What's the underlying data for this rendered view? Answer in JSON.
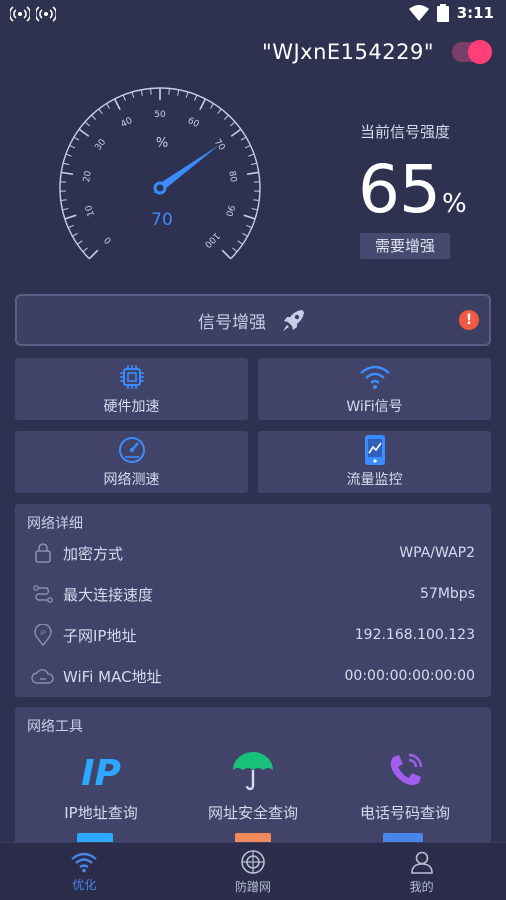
{
  "statusbar": {
    "time": "3:11",
    "icons": [
      "hotspot-icon",
      "hotspot-icon",
      "wifi-icon",
      "battery-icon"
    ]
  },
  "network": {
    "ssid": "\"WJxnE154229\"",
    "toggle_on": true
  },
  "gauge": {
    "value": 70,
    "unit": "%",
    "ticks": [
      "0",
      "10",
      "20",
      "30",
      "40",
      "50",
      "60",
      "70",
      "80",
      "90",
      "100"
    ],
    "accent": "#3a8cff"
  },
  "signal": {
    "label": "当前信号强度",
    "value": "65",
    "unit": "%",
    "badge": "需要增强"
  },
  "boost": {
    "label": "信号增强",
    "icon": "rocket-icon",
    "warning": "!"
  },
  "tiles": [
    {
      "label": "硬件加速",
      "icon": "chip-icon"
    },
    {
      "label": "WiFi信号",
      "icon": "wifi-icon"
    },
    {
      "label": "网络测速",
      "icon": "speedometer-icon"
    },
    {
      "label": "流量监控",
      "icon": "phone-chart-icon"
    }
  ],
  "details": {
    "title": "网络详细",
    "rows": [
      {
        "label": "加密方式",
        "value": "WPA/WAP2",
        "icon": "lock-icon"
      },
      {
        "label": "最大连接速度",
        "value": "57Mbps",
        "icon": "route-icon"
      },
      {
        "label": "子网IP地址",
        "value": "192.168.100.123",
        "icon": "ip-pin-icon"
      },
      {
        "label": "WiFi MAC地址",
        "value": "00:00:00:00:00:00",
        "icon": "cloud-icon"
      }
    ]
  },
  "tools": {
    "title": "网络工具",
    "items": [
      {
        "label": "IP地址查询",
        "icon": "ip-icon"
      },
      {
        "label": "网址安全查询",
        "icon": "umbrella-icon"
      },
      {
        "label": "电话号码查询",
        "icon": "phone-icon"
      }
    ]
  },
  "nav": [
    {
      "label": "优化",
      "icon": "wifi-icon",
      "active": true
    },
    {
      "label": "防蹭网",
      "icon": "radar-icon",
      "active": false
    },
    {
      "label": "我的",
      "icon": "user-icon",
      "active": false
    }
  ],
  "colors": {
    "background": "#2f3150",
    "card": "#414468",
    "accent": "#3a8cff",
    "toggle": "#ff3e7a",
    "warning": "#f15a45"
  }
}
